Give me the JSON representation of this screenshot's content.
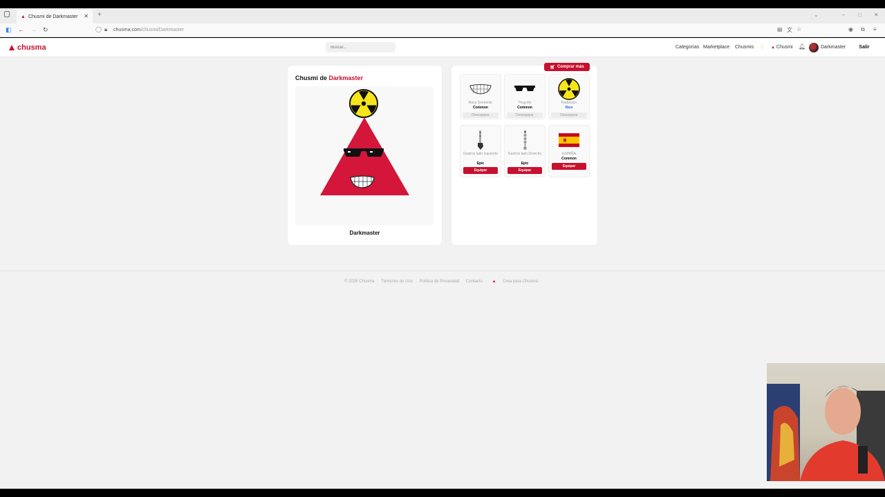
{
  "browser": {
    "tab_title": "Chusmi de Darkmaster",
    "url_domain": "chusma.com",
    "url_path": "/chusmi/Darkmaster"
  },
  "header": {
    "logo": "chusma",
    "search_placeholder": "Buscar...",
    "nav": [
      "Categorías",
      "Marketplace",
      "Chusmis"
    ],
    "chusmi_label": "Chusmi",
    "username": "Darkmaster",
    "logout": "Salir"
  },
  "profile": {
    "title_prefix": "Chusmi de ",
    "title_user": "Darkmaster",
    "character_name": "Darkmaster"
  },
  "inventory": {
    "buy_more": "Comprar más",
    "items": [
      {
        "name": "Boca Sonriente",
        "rarity": "Common",
        "rarity_color": "#333333",
        "action": "Desequipar",
        "equipped": true,
        "icon": "teeth-icon"
      },
      {
        "name": "Thug life",
        "rarity": "Common",
        "rarity_color": "#333333",
        "action": "Desequipar",
        "equipped": true,
        "icon": "sunglasses-icon"
      },
      {
        "name": "Radiacion",
        "rarity": "Rare",
        "rarity_color": "#2b6cd6",
        "action": "Desequipar",
        "equipped": true,
        "icon": "radiation-icon"
      },
      {
        "name": "Gastros lado Izquierdo",
        "rarity": "Epic",
        "rarity_color": "#333333",
        "action": "Equipar",
        "equipped": false,
        "icon": "left-arm-icon"
      },
      {
        "name": "Gastros lado Derecho",
        "rarity": "Epic",
        "rarity_color": "#333333",
        "action": "Equipar",
        "equipped": false,
        "icon": "right-arm-icon"
      },
      {
        "name": "ESPAÑA",
        "rarity": "Common",
        "rarity_color": "#333333",
        "action": "Equipar",
        "equipped": false,
        "icon": "spain-flag-icon"
      }
    ]
  },
  "footer": {
    "copyright": "© 2026 Chusma",
    "links": [
      "Términos de Uso",
      "Política de Privacidad",
      "Contacto"
    ],
    "create": "Crea para Chusma"
  }
}
